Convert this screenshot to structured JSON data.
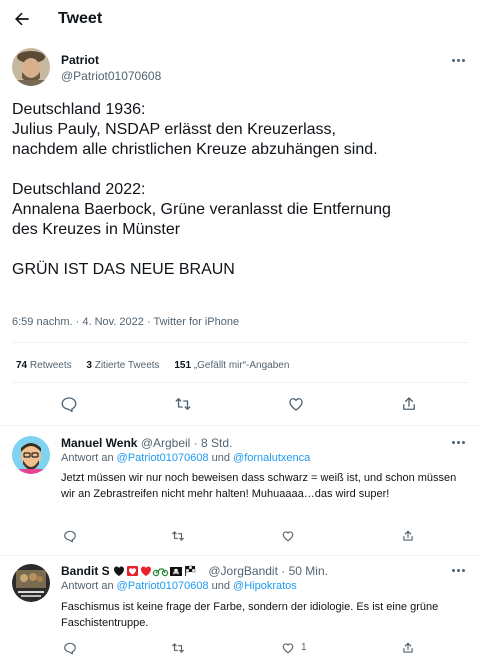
{
  "header": {
    "title": "Tweet"
  },
  "tweet": {
    "author_name": "Patriot",
    "author_handle": "@Patriot01070608",
    "paragraphs": [
      {
        "lines": [
          "Deutschland 1936:",
          "Julius Pauly, NSDAP erlässt den Kreuzerlass,",
          "nachdem alle christlichen Kreuze abzuhängen sind."
        ]
      },
      {
        "lines": [
          "Deutschland 2022:",
          "Annalena Baerbock, Grüne veranlasst die Entfernung",
          "des Kreuzes in Münster"
        ]
      },
      {
        "lines": [
          "GRÜN IST DAS NEUE BRAUN"
        ]
      }
    ],
    "time": "6:59 nachm.",
    "date": "4. Nov. 2022",
    "source": "Twitter for iPhone",
    "sep": "·",
    "stats": {
      "retweets_count": "74",
      "retweets_label": "Retweets",
      "quotes_count": "3",
      "quotes_label": "Zitierte Tweets",
      "likes_count": "151",
      "likes_label": "„Gefällt mir“-Angaben"
    }
  },
  "replies": [
    {
      "name": "Manuel Wenk",
      "handle": "@Argbeil",
      "sep": "·",
      "time": "8 Std.",
      "reply_to_prefix": "Antwort an",
      "mention_1": "@Patriot01070608",
      "and": "und",
      "mention_2": "@fornalutxenca",
      "text": "Jetzt müssen wir nur noch beweisen dass schwarz = weiß ist, und schon müssen wir an Zebrastreifen nicht mehr halten!  Muhuaaaa…das wird super!"
    },
    {
      "name": "Bandit S",
      "handle": "@JorgBandit",
      "sep": "·",
      "time": "50 Min.",
      "reply_to_prefix": "Antwort an",
      "mention_1": "@Patriot01070608",
      "and": "und",
      "mention_2": "@Hipokratos",
      "text": "Faschismus ist keine frage der Farbe, sondern der idiologie. Es ist eine grüne Faschistentruppe.",
      "like_count": "1"
    }
  ],
  "icons": {
    "back": "arrow-left-icon",
    "more": "more-dots-icon",
    "reply": "reply-bubble-icon",
    "retweet": "retweet-icon",
    "like": "heart-icon",
    "share": "share-icon"
  },
  "colors": {
    "link": "#1d9bf0",
    "secondary_text": "#536471",
    "divider": "#eff3f4"
  }
}
